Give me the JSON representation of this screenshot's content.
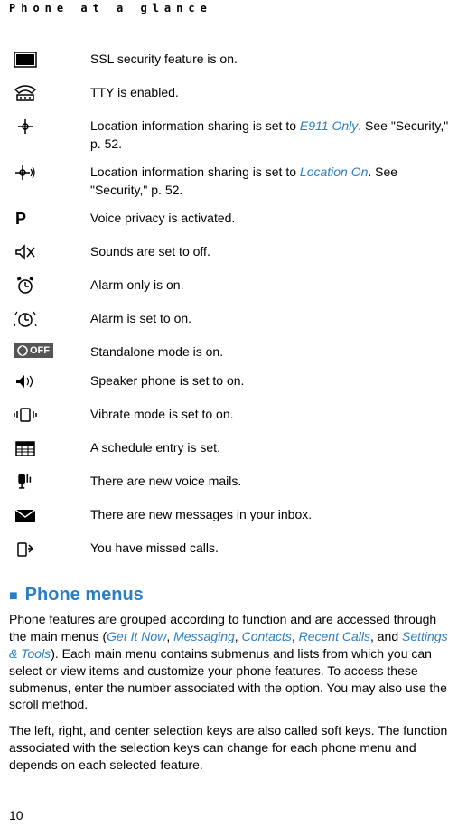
{
  "header": "Phone at a glance",
  "icons": [
    {
      "desc": "SSL security feature is on."
    },
    {
      "desc": "TTY is enabled."
    },
    {
      "desc_pre": "Location information sharing is set to ",
      "link": "E911 Only",
      "desc_post": ". See \"Security,\" p. 52."
    },
    {
      "desc_pre": "Location information sharing is set to ",
      "link": "Location On",
      "desc_post": ". See \"Security,\" p. 52."
    },
    {
      "desc": "Voice privacy is activated."
    },
    {
      "desc": "Sounds are set to off."
    },
    {
      "desc": "Alarm only is on."
    },
    {
      "desc": "Alarm is set to on."
    },
    {
      "desc": "Standalone mode is on.",
      "off_label": "OFF"
    },
    {
      "desc": "Speaker phone is set to on."
    },
    {
      "desc": "Vibrate mode is set to on."
    },
    {
      "desc": "A schedule entry is set."
    },
    {
      "desc": "There are new voice mails."
    },
    {
      "desc": "There are new messages in your inbox."
    },
    {
      "desc": "You have missed calls."
    }
  ],
  "section": {
    "title": "Phone menus",
    "para1_parts": [
      "Phone features are grouped according to function and are accessed through the main menus (",
      "Get It Now",
      ", ",
      "Messaging",
      ", ",
      "Contacts",
      ", ",
      "Recent Calls",
      ", and ",
      "Settings & Tools",
      "). Each main menu contains submenus and lists from which you can select or view items and customize your phone features. To access these submenus, enter the number associated with the option. You may also use the scroll method."
    ],
    "para2": "The left, right, and center selection keys are also called soft keys. The function associated with the selection keys can change for each phone menu and depends on each selected feature."
  },
  "page_number": "10"
}
